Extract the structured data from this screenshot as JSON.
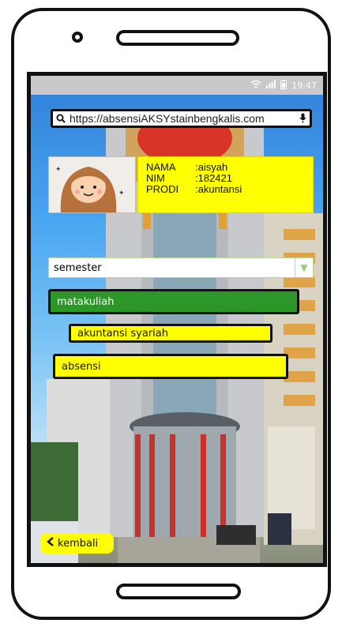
{
  "statusbar": {
    "wifi_icon": "wifi-icon",
    "signal_icon": "signal-icon",
    "battery_icon": "battery-icon",
    "time": "19:47"
  },
  "browser": {
    "url": "https://absensiAKSYstainbengkalis.com",
    "search_icon": "search-icon",
    "mic_icon": "microphone-icon"
  },
  "profile": {
    "name_label": "NAMA",
    "name_value": ":aisyah",
    "nim_label": "NIM",
    "nim_value": ":182421",
    "prodi_label": "PRODI",
    "prodi_value": ":akuntansi"
  },
  "semester": {
    "label": "semester",
    "dropdown_icon": "chevron-down-icon"
  },
  "menu": {
    "matakuliah": "matakuliah",
    "course": "akuntansi syariah",
    "absensi": "absensi"
  },
  "back": {
    "icon": "chevron-left-icon",
    "label": "kembali"
  },
  "colors": {
    "yellow": "#ffff00",
    "green": "#2d9629"
  }
}
